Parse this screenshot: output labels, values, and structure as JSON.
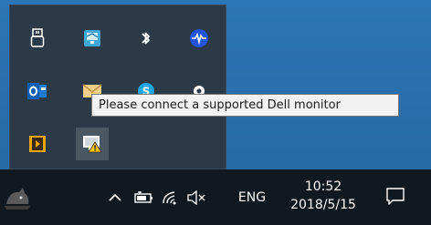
{
  "tooltip": {
    "text": "Please connect a supported Dell monitor"
  },
  "taskbar": {
    "language": "ENG",
    "time": "10:52",
    "date": "2018/5/15"
  },
  "tray_overflow_icons": [
    "usb-safely-remove-icon",
    "display-manager-icon",
    "bluetooth-icon",
    "audio-wave-icon",
    "outlook-icon",
    "mail-icon",
    "skype-icon",
    "app-icon",
    "video-app-icon",
    "dell-monitor-warning-icon"
  ],
  "colors": {
    "desktop": "#2a6fae",
    "panel": "#2c3a47",
    "taskbar": "#101820",
    "tooltip_bg": "#f2f2f2",
    "warning": "#f5c518"
  }
}
